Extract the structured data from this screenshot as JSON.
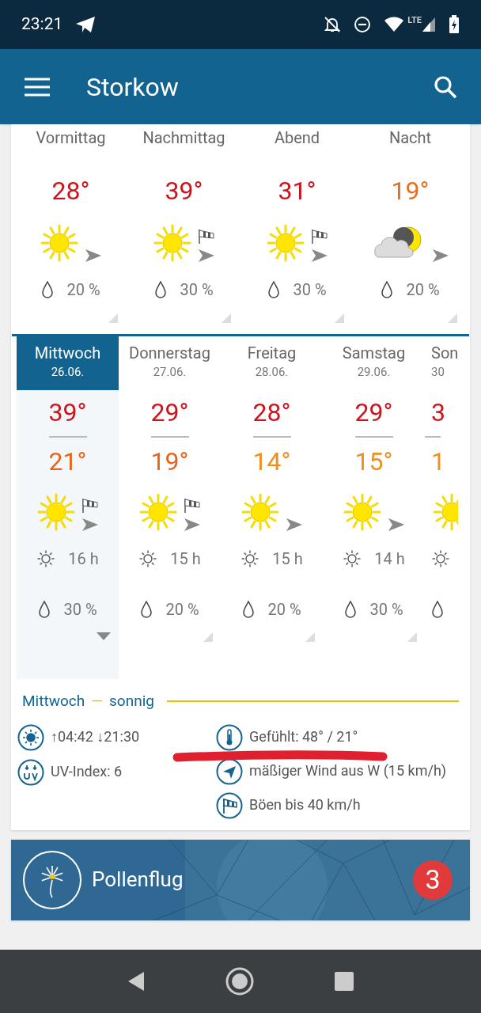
{
  "status_bar": {
    "time": "23:21",
    "network": "LTE"
  },
  "app_bar": {
    "title": "Storkow"
  },
  "day_parts": [
    {
      "label": "Vormittag",
      "temp": "28°",
      "color": "#d0121b",
      "kind": "sun",
      "gust": false,
      "rain": "20 %"
    },
    {
      "label": "Nachmittag",
      "temp": "39°",
      "color": "#d0121b",
      "kind": "sun",
      "gust": true,
      "rain": "30 %"
    },
    {
      "label": "Abend",
      "temp": "31°",
      "color": "#d0121b",
      "kind": "sun",
      "gust": true,
      "rain": "30 %"
    },
    {
      "label": "Nacht",
      "temp": "19°",
      "color": "#e8701d",
      "kind": "moon_cloud",
      "gust": false,
      "rain": "20 %"
    }
  ],
  "days": [
    {
      "name": "Mittwoch",
      "date": "26.06.",
      "selected": true,
      "high": "39°",
      "low": "21°",
      "color": "#e8641b",
      "kind": "sun",
      "gust": true,
      "sun_hours": "16 h",
      "rain": "30 %"
    },
    {
      "name": "Donnerstag",
      "date": "27.06.",
      "selected": false,
      "high": "29°",
      "low": "19°",
      "color": "#e8641b",
      "kind": "sun",
      "gust": true,
      "sun_hours": "15 h",
      "rain": "20 %"
    },
    {
      "name": "Freitag",
      "date": "28.06.",
      "selected": false,
      "high": "28°",
      "low": "14°",
      "color": "#ef8f1f",
      "kind": "sun",
      "gust": false,
      "sun_hours": "15 h",
      "rain": "20 %"
    },
    {
      "name": "Samstag",
      "date": "29.06.",
      "selected": false,
      "high": "29°",
      "low": "15°",
      "color": "#ef8f1f",
      "kind": "sun",
      "gust": false,
      "sun_hours": "14 h",
      "rain": "30 %"
    },
    {
      "name": "Son",
      "date": "30",
      "selected": false,
      "high": "3",
      "low": "1",
      "color": "#ef8f1f",
      "kind": "sun"
    }
  ],
  "summary": {
    "day": "Mittwoch",
    "separator": "—",
    "condition": "sonnig"
  },
  "details": [
    {
      "kind": "sun",
      "text": "↑04:42 ↓21:30"
    },
    {
      "kind": "feels",
      "text": "Gefühlt: 48° / 21°"
    },
    {
      "kind": "uv",
      "text": "UV-Index: 6"
    },
    {
      "kind": "wind",
      "text": "mäßiger Wind aus W (15 km/h)"
    },
    {
      "kind": "gust",
      "text": "Böen bis 40 km/h"
    }
  ],
  "pollen": {
    "title": "Pollenflug",
    "badge": "3"
  }
}
